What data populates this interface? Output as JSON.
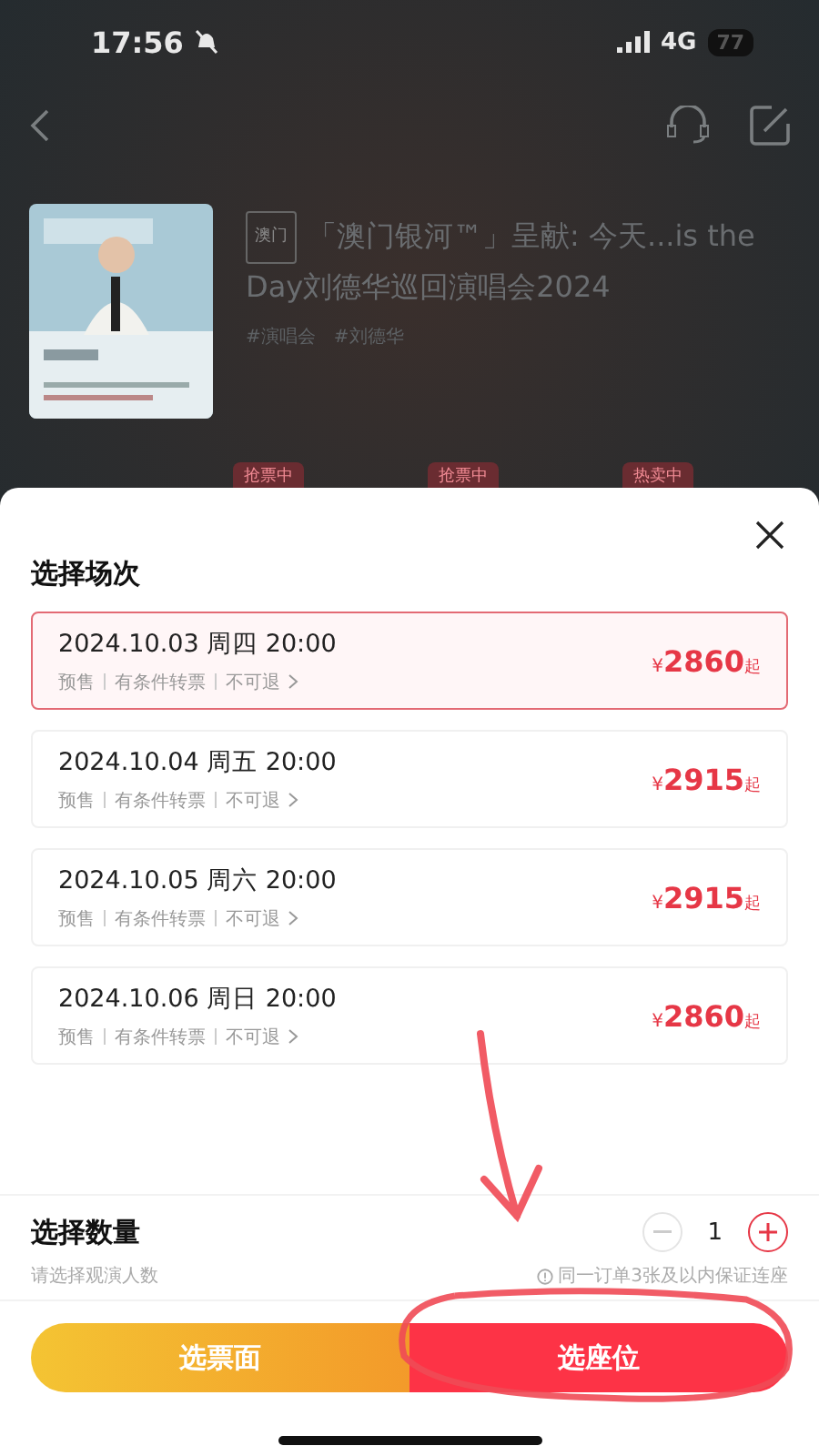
{
  "status_bar": {
    "time": "17:56",
    "network": "4G",
    "battery": "77"
  },
  "event": {
    "region_tag": "澳门",
    "title": "「澳门银河™」呈献: 今天...is the Day刘德华巡回演唱会2024",
    "tags": [
      "#演唱会",
      "#刘德华"
    ]
  },
  "background_badges": [
    "抢票中",
    "抢票中",
    "热卖中"
  ],
  "sheet": {
    "title": "选择场次",
    "sessions": [
      {
        "date": "2024.10.03 周四 20:00",
        "notes": [
          "预售",
          "有条件转票",
          "不可退"
        ],
        "currency": "¥",
        "price": "2860",
        "suffix": "起",
        "selected": true
      },
      {
        "date": "2024.10.04 周五 20:00",
        "notes": [
          "预售",
          "有条件转票",
          "不可退"
        ],
        "currency": "¥",
        "price": "2915",
        "suffix": "起",
        "selected": false
      },
      {
        "date": "2024.10.05 周六 20:00",
        "notes": [
          "预售",
          "有条件转票",
          "不可退"
        ],
        "currency": "¥",
        "price": "2915",
        "suffix": "起",
        "selected": false
      },
      {
        "date": "2024.10.06 周日 20:00",
        "notes": [
          "预售",
          "有条件转票",
          "不可退"
        ],
        "currency": "¥",
        "price": "2860",
        "suffix": "起",
        "selected": false
      }
    ],
    "quantity": {
      "title": "选择数量",
      "subtitle": "请选择观演人数",
      "value": "1",
      "hint": "同一订单3张及以内保证连座",
      "decrease_disabled": true
    },
    "buttons": [
      {
        "label": "选票面",
        "kind": "secondary"
      },
      {
        "label": "选座位",
        "kind": "primary"
      }
    ]
  }
}
